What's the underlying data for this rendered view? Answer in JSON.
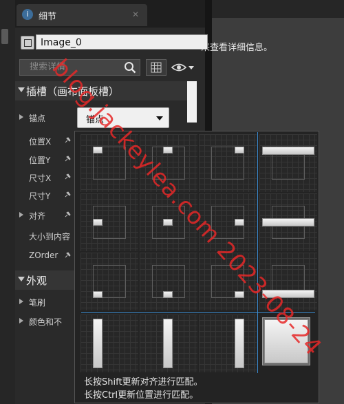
{
  "tab": {
    "title": "细节",
    "icon": "magnifier-icon"
  },
  "right_hint": "来查看详细信息。",
  "name_field": {
    "value": "Image_0"
  },
  "search": {
    "placeholder": "搜索详情"
  },
  "sections": {
    "slot": "插槽（画布面板槽）",
    "appearance": "外观"
  },
  "rows": {
    "anchors": "锚点",
    "pos_x": "位置X",
    "pos_y": "位置Y",
    "size_x": "尺寸X",
    "size_y": "尺寸Y",
    "alignment": "对齐",
    "size_to_content": "大小到内容",
    "zorder": "ZOrder",
    "brush": "笔刷",
    "color_opacity": "颜色和不"
  },
  "anchor_dropdown": {
    "value": "锚点"
  },
  "popup": {
    "hint_shift": "长按Shift更新对齐进行匹配。",
    "hint_ctrl": "长按Ctrl更新位置进行匹配。"
  },
  "watermark": "blog.jackeylea.com 2023-08-24",
  "colors": {
    "accent_line": "#3a8bd0",
    "watermark": "#e62828",
    "panel_bg": "#2a2a2a"
  }
}
